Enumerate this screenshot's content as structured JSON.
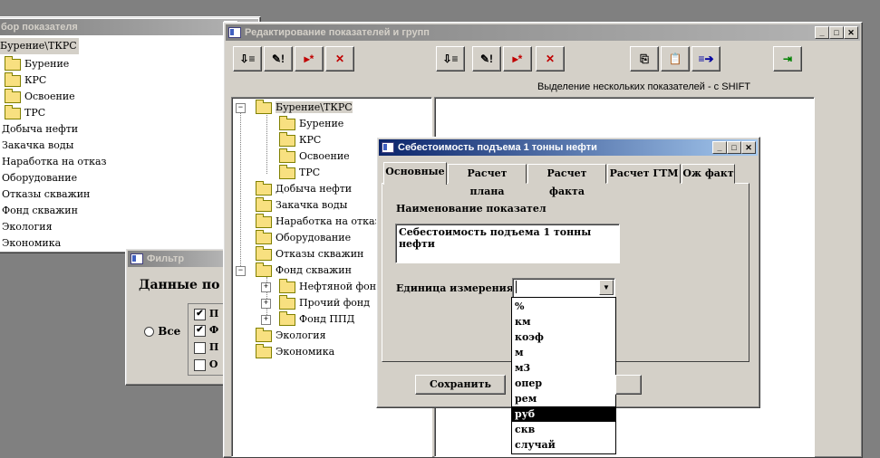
{
  "bg_window": {
    "title": "бор показателя",
    "items": [
      "Бурение\\ТКРС",
      "Бурение",
      "КРС",
      "Освоение",
      "ТРС",
      "Добыча нефти",
      "Закачка воды",
      "Наработка на отказ",
      "Оборудование",
      "Отказы скважин",
      "Фонд скважин",
      "Экология",
      "Экономика"
    ]
  },
  "filter_window": {
    "title": "Фильтр",
    "heading": "Данные по",
    "radio_all": "Все",
    "checks": [
      {
        "label": "П",
        "checked": true
      },
      {
        "label": "Ф",
        "checked": true
      },
      {
        "label": "П",
        "checked": false
      },
      {
        "label": "О",
        "checked": false
      }
    ]
  },
  "main_window": {
    "title": "Редактирование показателей и групп",
    "hint": "Выделение нескольких показателей - с SHIFT",
    "toolbar_left": [
      "⇩≡",
      "✎!",
      "▸*",
      "✕"
    ],
    "toolbar_right": [
      "⇩≡",
      "✎!",
      "▸*",
      "✕"
    ],
    "toolbar_extra": [
      "⎘",
      "📋",
      "≡➔"
    ],
    "exit_icon": "⇥",
    "tree": [
      "Бурение\\ТКРС",
      "Бурение",
      "КРС",
      "Освоение",
      "ТРС",
      "Добыча нефти",
      "Закачка воды",
      "Наработка на отказ",
      "Оборудование",
      "Отказы скважин",
      "Фонд скважин",
      "Нефтяной фонд",
      "Прочий фонд",
      "Фонд ППД",
      "Экология",
      "Экономика"
    ]
  },
  "dialog": {
    "title": "Себестоимость подъема 1 тонны нефти",
    "tabs": [
      "Основные",
      "Расчет плана",
      "Расчет факта",
      "Расчет ГТМ",
      "Ож факт"
    ],
    "name_label": "Наименование показател",
    "name_value": "Себестоимость подъема 1 тонны нефти",
    "unit_label": "Единица измерения:",
    "unit_value": "",
    "save_label": "Сохранить",
    "dropdown": [
      "%",
      "км",
      "коэф",
      "м",
      "м3",
      "опер",
      "рем",
      "руб",
      "скв",
      "случай"
    ],
    "dropdown_selected": "руб"
  }
}
